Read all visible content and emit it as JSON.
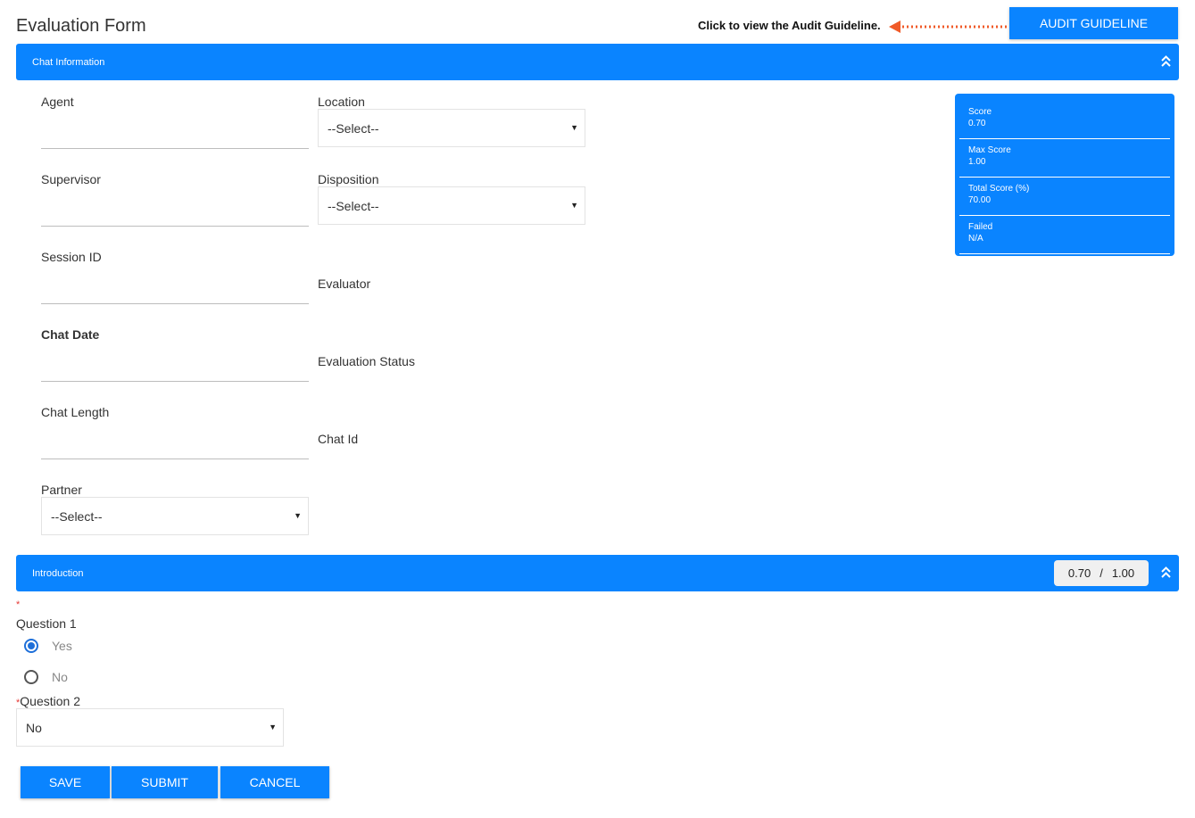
{
  "header": {
    "title": "Evaluation Form",
    "callout_text": "Click to view the Audit Guideline.",
    "audit_button": "AUDIT GUIDELINE"
  },
  "chat_info": {
    "section_title": "Chat Information",
    "fields": {
      "agent": "Agent",
      "supervisor": "Supervisor",
      "session_id": "Session ID",
      "chat_date": "Chat Date",
      "chat_length": "Chat Length",
      "partner": "Partner",
      "location": "Location",
      "disposition": "Disposition",
      "evaluator": "Evaluator",
      "evaluation_status": "Evaluation Status",
      "chat_id": "Chat Id"
    },
    "select_placeholder": "--Select--"
  },
  "score_card": {
    "score_label": "Score",
    "score_value": "0.70",
    "max_label": "Max Score",
    "max_value": "1.00",
    "total_label": "Total Score (%)",
    "total_value": "70.00",
    "failed_label": "Failed",
    "failed_value": "N/A"
  },
  "introduction": {
    "section_title": "Introduction",
    "score": "0.70",
    "separator": "/",
    "max": "1.00",
    "q1_label": "Question 1",
    "q1_options": [
      "Yes",
      "No"
    ],
    "q1_selected": "Yes",
    "q2_label": "Question 2",
    "q2_value": "No",
    "required_mark": "*"
  },
  "actions": {
    "save": "SAVE",
    "submit": "SUBMIT",
    "cancel": "CANCEL"
  },
  "colors": {
    "primary": "#0a84ff",
    "callout_arrow": "#f05a28",
    "required": "#e53935"
  },
  "icons": {
    "collapse": "double-chevron-up-icon",
    "caret": "caret-down-icon",
    "arrow": "arrow-left-icon"
  }
}
